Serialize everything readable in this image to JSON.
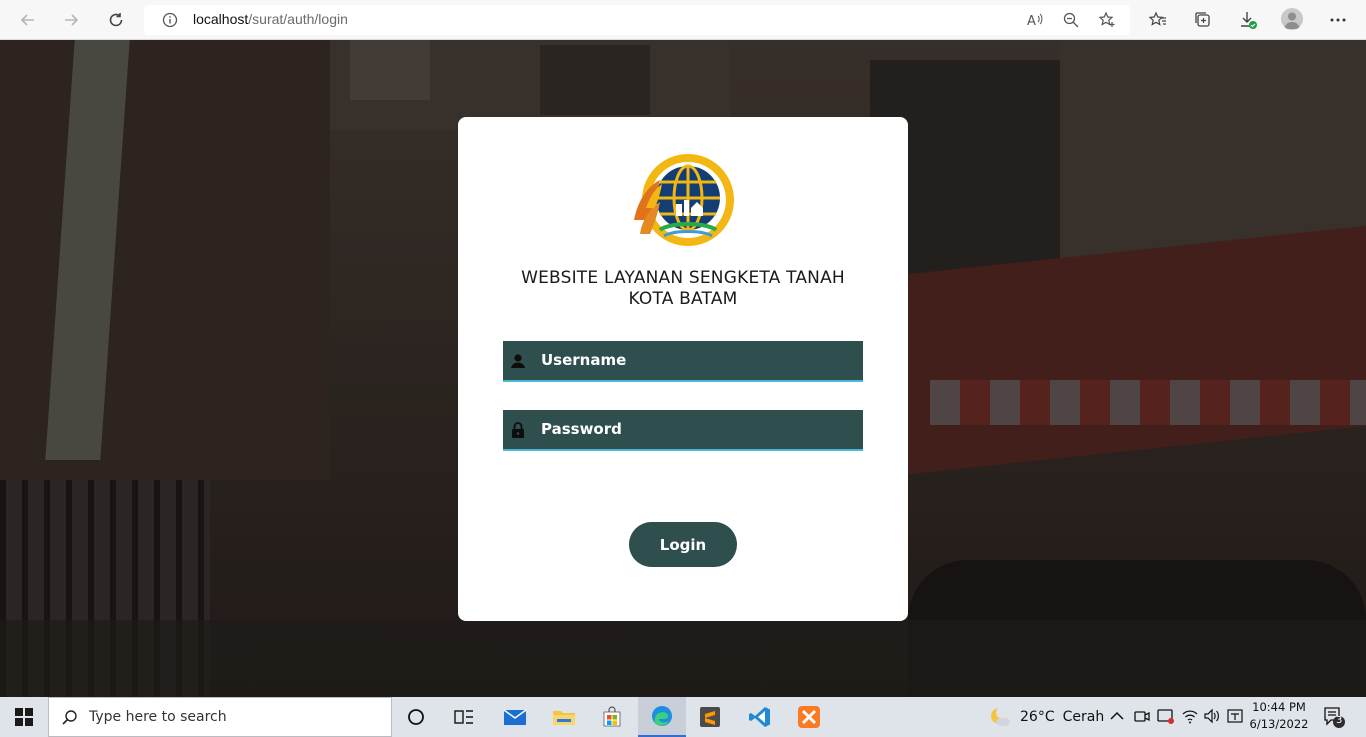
{
  "browser": {
    "url_host": "localhost",
    "url_path": "/surat/auth/login"
  },
  "login": {
    "title_line1": "WEBSITE LAYANAN SENGKETA TANAH",
    "title_line2": "KOTA BATAM",
    "username_placeholder": "Username",
    "password_placeholder": "Password",
    "login_label": "Login"
  },
  "taskbar": {
    "search_placeholder": "Type here to search",
    "weather_temp": "26°C",
    "weather_desc": "Cerah",
    "time": "10:44 PM",
    "date": "6/13/2022",
    "notification_count": "3"
  },
  "colors": {
    "field_bg": "#2f4f4f",
    "field_underline": "#49b7d8",
    "button_bg": "#2f4f4f",
    "card_bg": "#ffffff"
  },
  "icons": {
    "back": "arrow-left-icon",
    "forward": "arrow-right-icon",
    "refresh": "refresh-icon",
    "info": "info-icon",
    "read_aloud": "read-aloud-icon",
    "zoom": "zoom-out-icon",
    "add_favorite": "add-favorite-icon",
    "favorites": "favorites-icon",
    "collections": "collections-icon",
    "downloads": "download-icon",
    "profile": "profile-icon",
    "menu": "more-icon",
    "user": "user-icon",
    "lock": "lock-icon"
  }
}
